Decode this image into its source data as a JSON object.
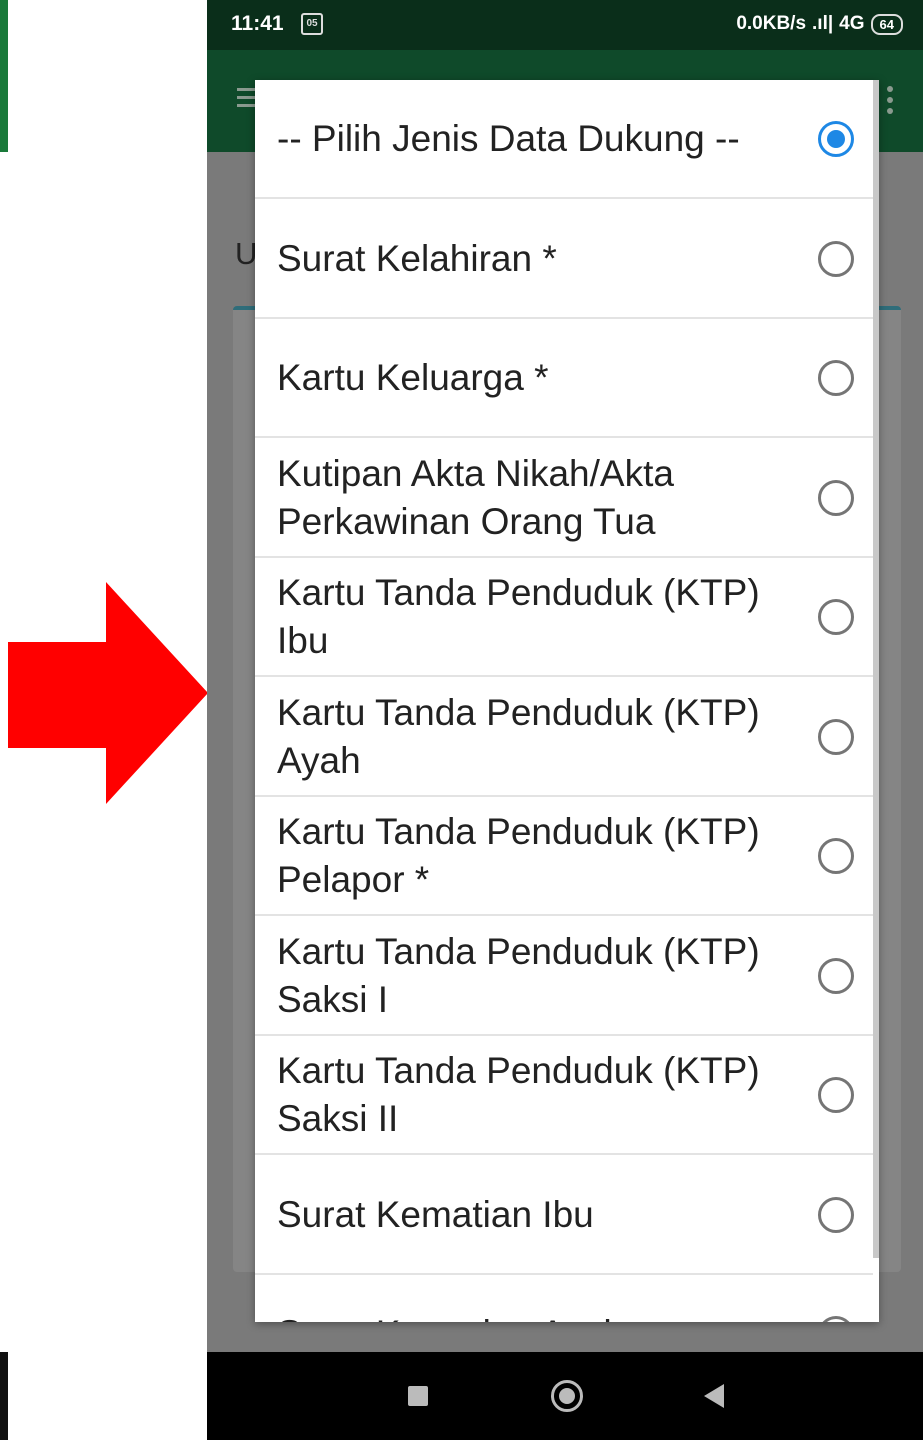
{
  "status_bar": {
    "time": "11:41",
    "notification_badge": "05",
    "network_speed": "0.0KB/s",
    "signal_type": "4G",
    "battery": "64"
  },
  "background": {
    "heading_fragment": "U"
  },
  "dialog": {
    "options": [
      {
        "label": "-- Pilih Jenis Data Dukung --",
        "selected": true
      },
      {
        "label": "Surat Kelahiran *",
        "selected": false
      },
      {
        "label": "Kartu Keluarga *",
        "selected": false
      },
      {
        "label": "Kutipan Akta Nikah/Akta\nPerkawinan Orang Tua",
        "selected": false
      },
      {
        "label": "Kartu Tanda Penduduk (KTP)\nIbu",
        "selected": false
      },
      {
        "label": "Kartu Tanda Penduduk (KTP)\nAyah",
        "selected": false
      },
      {
        "label": "Kartu Tanda Penduduk (KTP)\nPelapor *",
        "selected": false
      },
      {
        "label": "Kartu Tanda Penduduk (KTP)\nSaksi I",
        "selected": false
      },
      {
        "label": "Kartu Tanda Penduduk (KTP)\nSaksi II",
        "selected": false
      },
      {
        "label": "Surat Kematian Ibu",
        "selected": false
      },
      {
        "label": "Surat Kematian Ayah",
        "selected": false
      }
    ]
  },
  "colors": {
    "accent": "#1e88e5",
    "annotation_arrow": "#ff0000",
    "app_bar": "#0f4a2a"
  },
  "icons": [
    "menu-icon",
    "more-vert-icon",
    "radio-button-icon",
    "annotation-arrow",
    "nav-recents-icon",
    "nav-home-icon",
    "nav-back-icon"
  ]
}
